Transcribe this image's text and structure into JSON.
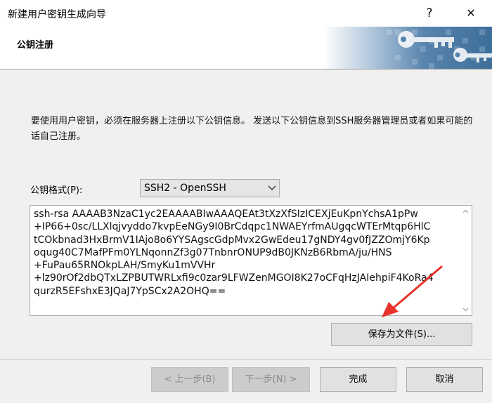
{
  "window": {
    "title": "新建用户密钥生成向导",
    "help_label": "?",
    "close_label": "✕"
  },
  "header": {
    "title": "公钥注册",
    "art_icon": "keys-banner-icon"
  },
  "main": {
    "description": "要使用用户密钥，必须在服务器上注册以下公钥信息。 发送以下公钥信息到SSH服务器管理员或者如果可能的话自己注册。",
    "format_label": "公钥格式(P):",
    "format_value": "SSH2 - OpenSSH",
    "public_key": "ssh-rsa AAAAB3NzaC1yc2EAAAABIwAAAQEAt3tXzXfSIzICEXjEuKpnYchsA1pPw\n+IP66+0sc/LLXlqjvyddo7kvpEeNGy9I0BrCdqpc1NWAEYrfmAUgqcWTErMtqp6HlC\ntCOkbnad3HxBrmV1IAjo8o6YYSAgscGdpMvx2GwEdeu17gNDY4gv0fJZZOmjY6Kp\noqug40C7MafPFm0YLNqonnZf3g07TnbnrONUP9dB0JKNzB6RbmA/ju/HNS\n+FuPau65RNOkpLAH/SmyKu1mVVHr\n+lz90rOf2dbQTxLZPBUTWRLxfi9c0zar9LFWZenMGOI8K27oCFqHzJAIehpiF4KoRa4\nqurzR5EFshxE3JQaJ7YpSCx2A2OHQ==",
    "save_label": "保存为文件(S)..."
  },
  "footer": {
    "back_label": "< 上一步(B)",
    "next_label": "下一步(N) >",
    "finish_label": "完成",
    "cancel_label": "取消"
  },
  "colors": {
    "banner_blue": "#3d6e99",
    "annotation_arrow": "#e8332b"
  }
}
